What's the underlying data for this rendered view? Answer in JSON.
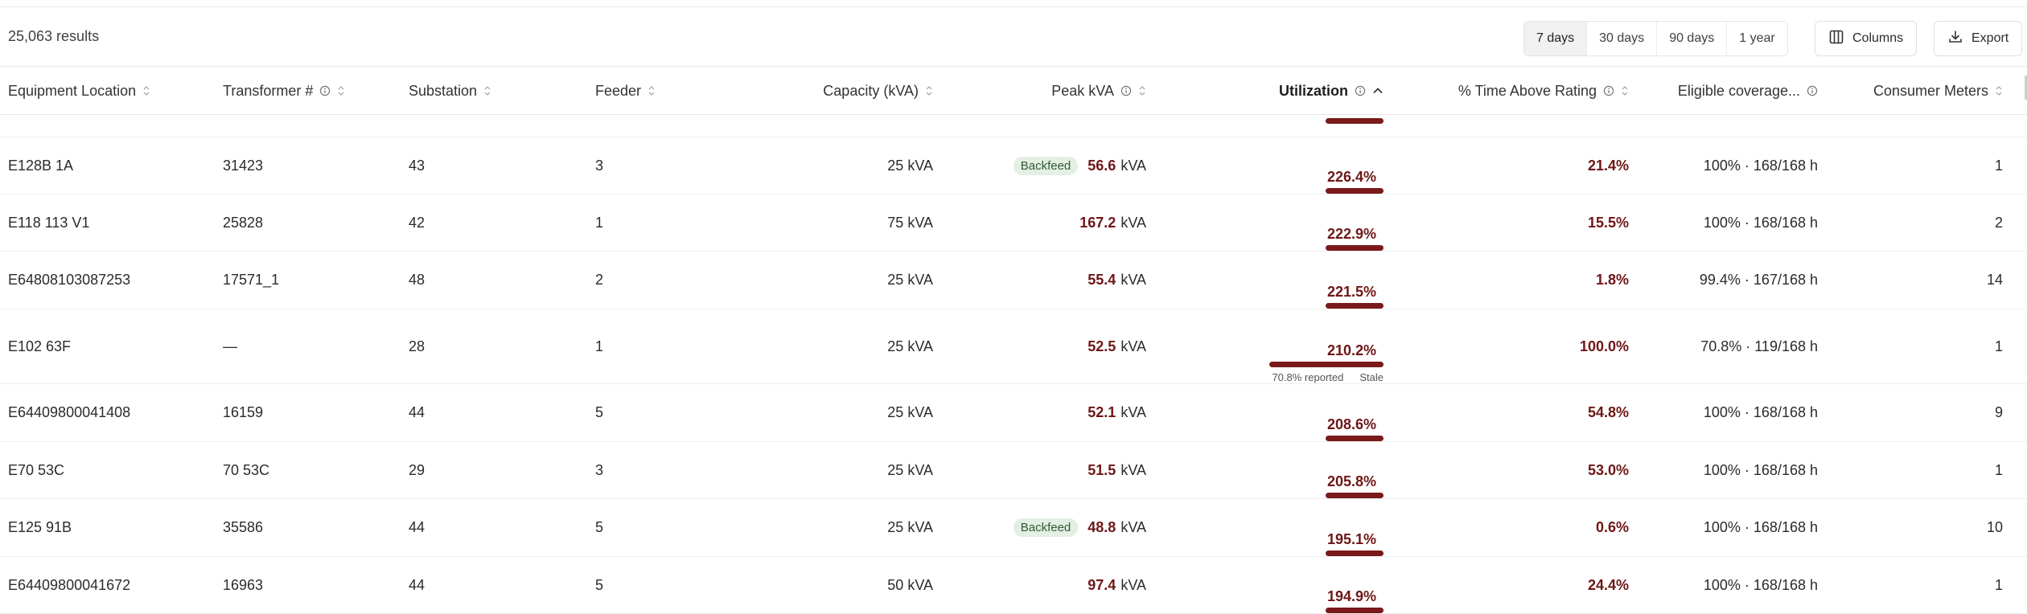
{
  "toolbar": {
    "results": "25,063 results",
    "ranges": [
      "7 days",
      "30 days",
      "90 days",
      "1 year"
    ],
    "active_range": "7 days",
    "columns_label": "Columns",
    "export_label": "Export"
  },
  "columns": [
    {
      "label": "Equipment Location",
      "info": false,
      "sort": "none"
    },
    {
      "label": "Transformer #",
      "info": true,
      "sort": "none"
    },
    {
      "label": "Substation",
      "info": false,
      "sort": "none"
    },
    {
      "label": "Feeder",
      "info": false,
      "sort": "none"
    },
    {
      "label": "Capacity (kVA)",
      "info": false,
      "sort": "none"
    },
    {
      "label": "Peak kVA",
      "info": true,
      "sort": "none"
    },
    {
      "label": "Utilization",
      "info": true,
      "sort": "asc"
    },
    {
      "label": "% Time Above Rating",
      "info": true,
      "sort": "none"
    },
    {
      "label": "Eligible coverage...",
      "info": true,
      "sort": null
    },
    {
      "label": "Consumer Meters",
      "info": false,
      "sort": "none"
    }
  ],
  "unit_kva": "kVA",
  "rows": [
    {
      "location": "E128B 1A",
      "transformer": "31423",
      "substation": "43",
      "feeder": "3",
      "capacity": "25 kVA",
      "badge": "Backfeed",
      "peak": "56.6",
      "util": "226.4%",
      "util_fill": 1.0,
      "note": null,
      "stale": null,
      "time_above": "21.4%",
      "coverage": "100% · 168/168 h",
      "meters": "1"
    },
    {
      "location": "E118 113 V1",
      "transformer": "25828",
      "substation": "42",
      "feeder": "1",
      "capacity": "75 kVA",
      "badge": null,
      "peak": "167.2",
      "util": "222.9%",
      "util_fill": 1.0,
      "note": null,
      "stale": null,
      "time_above": "15.5%",
      "coverage": "100% · 168/168 h",
      "meters": "2"
    },
    {
      "location": "E64808103087253",
      "transformer": "17571_1",
      "substation": "48",
      "feeder": "2",
      "capacity": "25 kVA",
      "badge": null,
      "peak": "55.4",
      "util": "221.5%",
      "util_fill": 1.0,
      "note": null,
      "stale": null,
      "time_above": "1.8%",
      "coverage": "99.4% · 167/168 h",
      "meters": "14"
    },
    {
      "location": "E102 63F",
      "transformer": "—",
      "substation": "28",
      "feeder": "1",
      "capacity": "25 kVA",
      "badge": null,
      "peak": "52.5",
      "util": "210.2%",
      "util_fill": 1.0,
      "note": "70.8% reported",
      "stale": "Stale",
      "time_above": "100.0%",
      "coverage": "70.8% · 119/168 h",
      "meters": "1"
    },
    {
      "location": "E64409800041408",
      "transformer": "16159",
      "substation": "44",
      "feeder": "5",
      "capacity": "25 kVA",
      "badge": null,
      "peak": "52.1",
      "util": "208.6%",
      "util_fill": 1.0,
      "note": null,
      "stale": null,
      "time_above": "54.8%",
      "coverage": "100% · 168/168 h",
      "meters": "9"
    },
    {
      "location": "E70 53C",
      "transformer": "70 53C",
      "substation": "29",
      "feeder": "3",
      "capacity": "25 kVA",
      "badge": null,
      "peak": "51.5",
      "util": "205.8%",
      "util_fill": 1.0,
      "note": null,
      "stale": null,
      "time_above": "53.0%",
      "coverage": "100% · 168/168 h",
      "meters": "1"
    },
    {
      "location": "E125 91B",
      "transformer": "35586",
      "substation": "44",
      "feeder": "5",
      "capacity": "25 kVA",
      "badge": "Backfeed",
      "peak": "48.8",
      "util": "195.1%",
      "util_fill": 1.0,
      "note": null,
      "stale": null,
      "time_above": "0.6%",
      "coverage": "100% · 168/168 h",
      "meters": "10"
    },
    {
      "location": "E64409800041672",
      "transformer": "16963",
      "substation": "44",
      "feeder": "5",
      "capacity": "50 kVA",
      "badge": null,
      "peak": "97.4",
      "util": "194.9%",
      "util_fill": 1.0,
      "note": null,
      "stale": null,
      "time_above": "24.4%",
      "coverage": "100% · 168/168 h",
      "meters": "1"
    }
  ],
  "colors": {
    "accent": "#7a1a1a",
    "value_text": "#6e1616",
    "badge_bg": "#e4efe4",
    "badge_text": "#2f5a35"
  }
}
